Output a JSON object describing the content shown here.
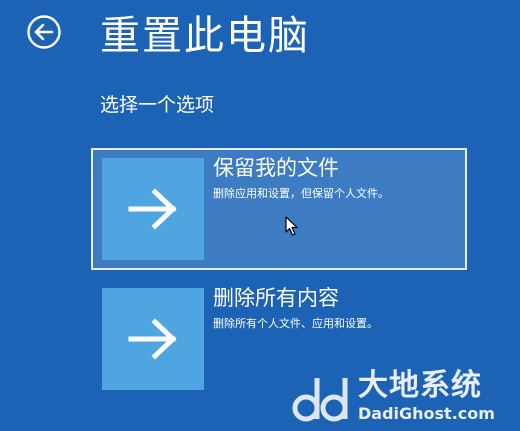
{
  "header": {
    "back_icon": "back-arrow-circle-icon",
    "title": "重置此电脑"
  },
  "subtitle": "选择一个选项",
  "options": [
    {
      "title": "保留我的文件",
      "description": "删除应用和设置，但保留个人文件。",
      "icon": "arrow-right-icon",
      "selected": true
    },
    {
      "title": "删除所有内容",
      "description": "删除所有个人文件、应用和设置。",
      "icon": "arrow-right-icon",
      "selected": false
    }
  ],
  "watermark": {
    "brand": "大地系统",
    "url": "DadiGhost.com"
  },
  "colors": {
    "background": "#1c63b5",
    "selected_background": "#3d7cc3",
    "tile": "#4fa5e0",
    "text": "#ffffff"
  }
}
